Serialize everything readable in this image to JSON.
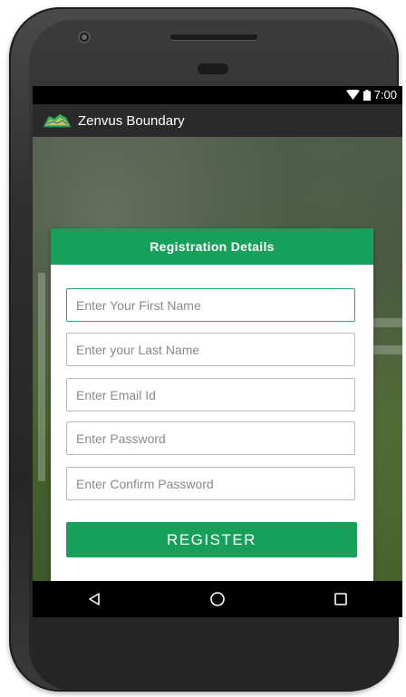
{
  "status_bar": {
    "time": "7:00",
    "icons": [
      "wifi-icon",
      "battery-icon"
    ]
  },
  "app_bar": {
    "title": "Zenvus Boundary",
    "logo_icon": "map-logo-icon"
  },
  "form": {
    "header": "Registration Details",
    "fields": [
      {
        "name": "first-name-field",
        "placeholder": "Enter Your First Name",
        "value": ""
      },
      {
        "name": "last-name-field",
        "placeholder": "Enter your Last Name",
        "value": ""
      },
      {
        "name": "email-field",
        "placeholder": "Enter Email Id",
        "value": ""
      },
      {
        "name": "password-field",
        "placeholder": "Enter Password",
        "value": ""
      },
      {
        "name": "confirm-password-field",
        "placeholder": "Enter Confirm Password",
        "value": ""
      }
    ],
    "submit_label": "REGISTER"
  },
  "nav_bar": {
    "buttons": [
      "back-icon",
      "home-icon",
      "recents-icon"
    ]
  },
  "colors": {
    "accent": "#16a05a",
    "status_bar": "#000000",
    "app_bar": "#2a2a2a",
    "focused_border": "#2eaa6a"
  }
}
